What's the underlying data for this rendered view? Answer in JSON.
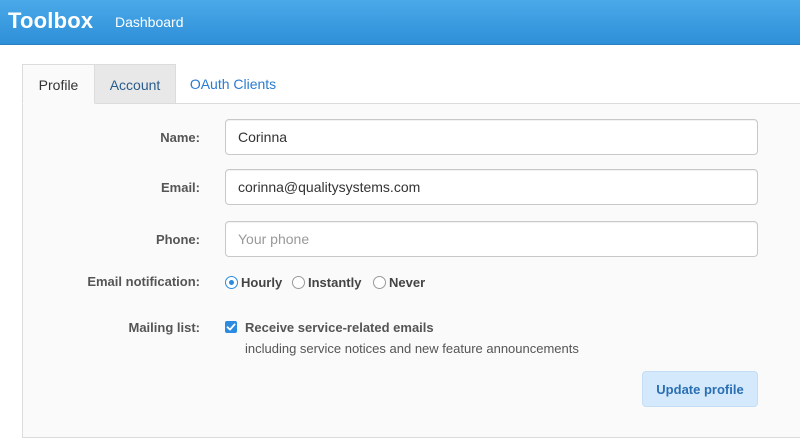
{
  "navbar": {
    "brand": "Toolbox",
    "links": [
      {
        "label": "Dashboard"
      }
    ]
  },
  "tabs": [
    {
      "label": "Profile",
      "active": true
    },
    {
      "label": "Account",
      "active": false
    },
    {
      "label": "OAuth Clients",
      "active": false
    }
  ],
  "form": {
    "name": {
      "label": "Name:",
      "value": "Corinna",
      "placeholder": ""
    },
    "email": {
      "label": "Email:",
      "value": "corinna@qualitysystems.com",
      "placeholder": ""
    },
    "phone": {
      "label": "Phone:",
      "value": "",
      "placeholder": "Your phone"
    },
    "notification": {
      "label": "Email notification:",
      "options": [
        {
          "label": "Hourly",
          "checked": true
        },
        {
          "label": "Instantly",
          "checked": false
        },
        {
          "label": "Never",
          "checked": false
        }
      ]
    },
    "mailing": {
      "label": "Mailing list:",
      "checked": true,
      "option_label": "Receive service-related emails",
      "help": "including service notices and new feature announcements"
    },
    "submit_label": "Update profile"
  },
  "colors": {
    "navbar": "#3a9de3",
    "accent": "#2a8be0",
    "button_bg": "#d4e9fb"
  },
  "icons": {
    "radio_checked": "radio-checked-icon",
    "checkbox_checked": "checkbox-checked-icon"
  }
}
